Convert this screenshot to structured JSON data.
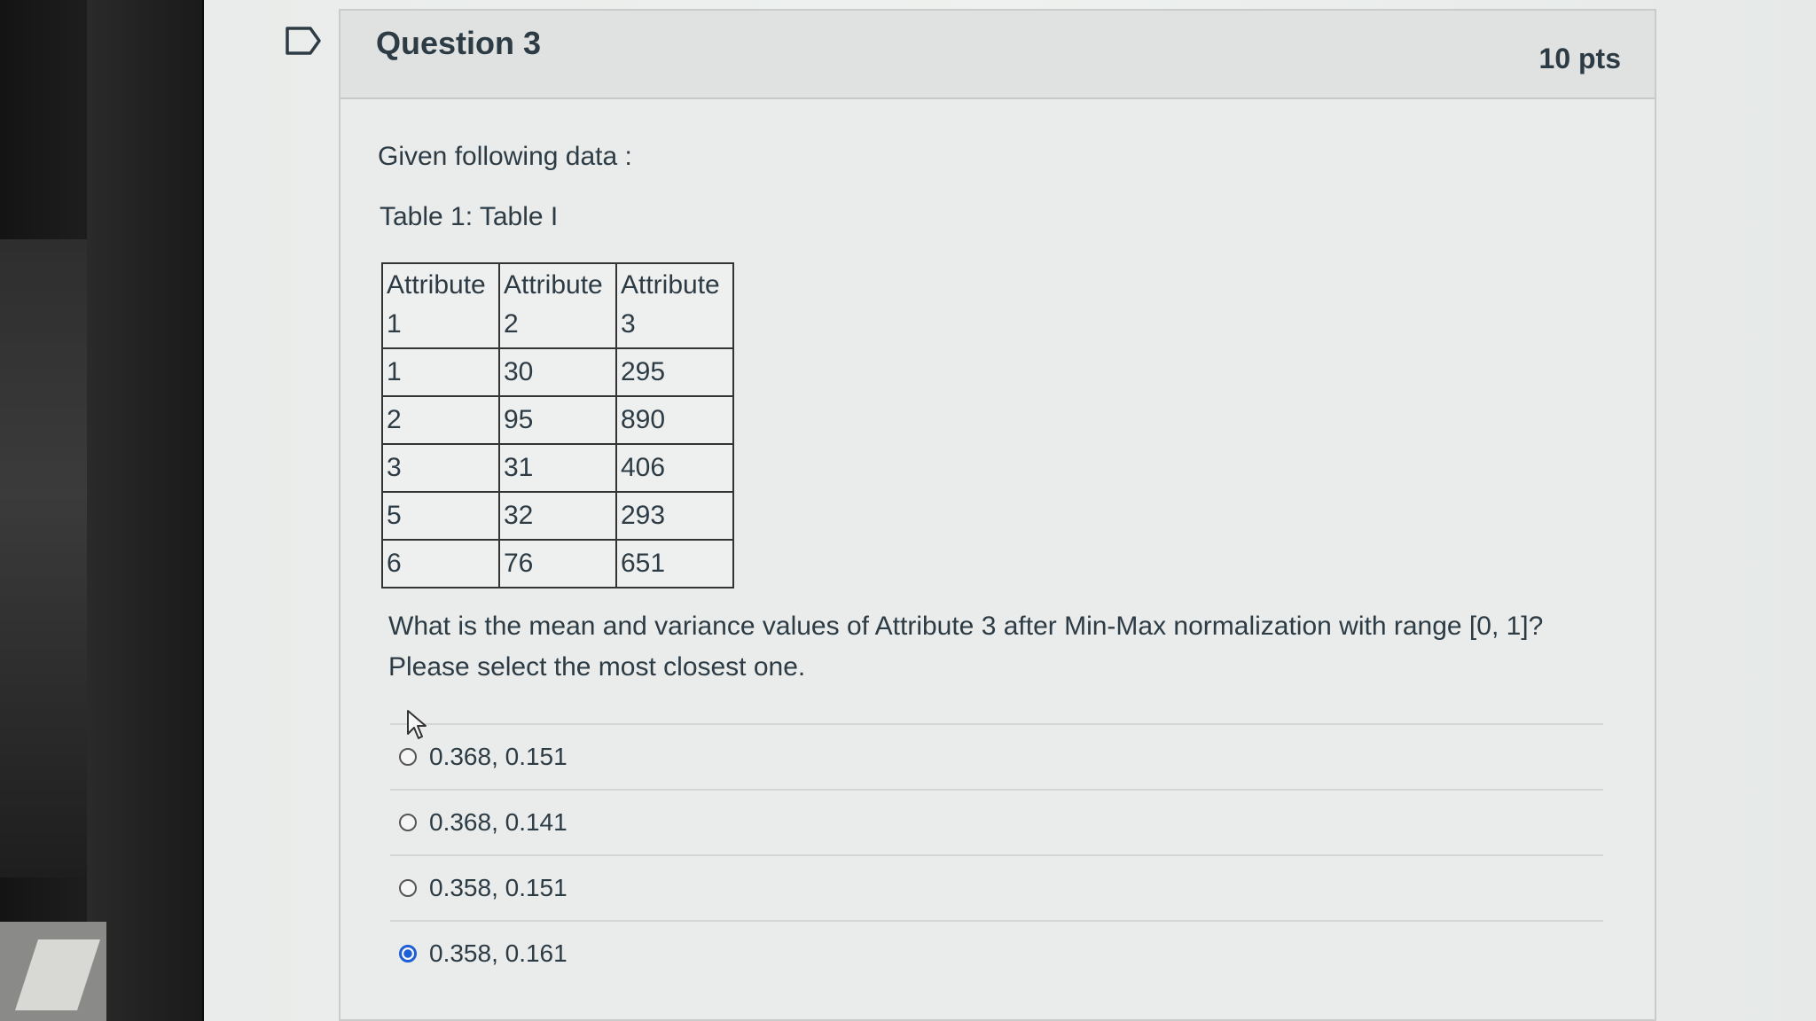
{
  "question": {
    "title": "Question 3",
    "points": "10 pts",
    "intro": "Given following data :",
    "table_caption": "Table 1: Table I",
    "table": {
      "headers": [
        "Attribute 1",
        "Attribute 2",
        "Attribute 3"
      ],
      "rows": [
        [
          "1",
          "30",
          "295"
        ],
        [
          "2",
          "95",
          "890"
        ],
        [
          "3",
          "31",
          "406"
        ],
        [
          "5",
          "32",
          "293"
        ],
        [
          "6",
          "76",
          "651"
        ]
      ]
    },
    "prompt": "What is the mean and variance values of Attribute 3 after Min-Max normalization with range [0, 1]? Please select the most closest one.",
    "answers": [
      {
        "label": "0.368, 0.151",
        "selected": false
      },
      {
        "label": "0.368, 0.141",
        "selected": false
      },
      {
        "label": "0.358, 0.151",
        "selected": false
      },
      {
        "label": "0.358, 0.161",
        "selected": true
      }
    ]
  },
  "colors": {
    "text": "#2d3b45",
    "selected_radio": "#1d5fd6"
  }
}
